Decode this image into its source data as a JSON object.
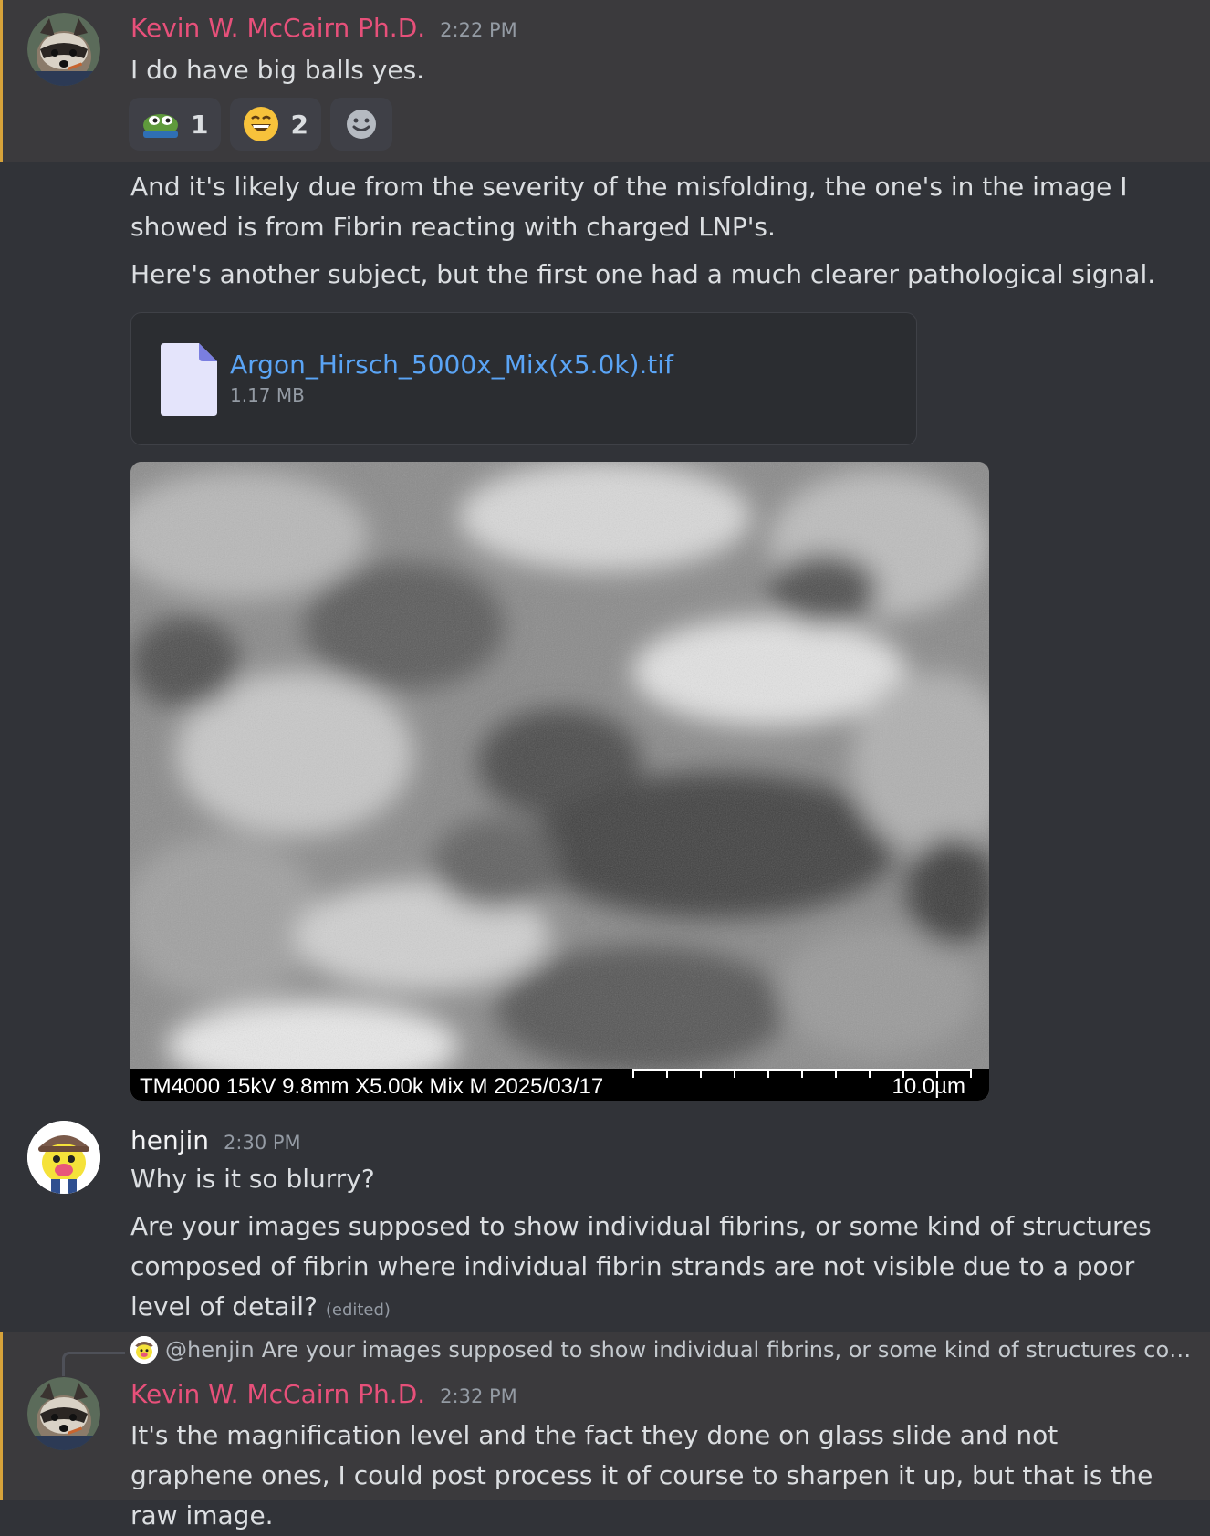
{
  "messages": {
    "kevin1": {
      "username": "Kevin W. McCairn Ph.D.",
      "timestamp": "2:22 PM",
      "text": "I do have big balls yes.",
      "reactions": [
        {
          "emoji": "pepe-frog-icon",
          "count": "1"
        },
        {
          "emoji": "grinning-face-icon",
          "count": "2"
        },
        {
          "emoji": "add-reaction-icon",
          "count": ""
        }
      ]
    },
    "kevin_cont": {
      "text1": "And it's likely due from the severity of the misfolding, the one's in the image I showed is from Fibrin reacting with charged LNP's.",
      "text2": "Here's another subject, but the first one had a much clearer pathological signal.",
      "file": {
        "name": "Argon_Hirsch_5000x_Mix(x5.0k).tif",
        "size": "1.17 MB"
      },
      "image": {
        "caption": "TM4000 15kV 9.8mm X5.00k Mix M 2025/03/17",
        "scale": "10.0µm"
      }
    },
    "henjin": {
      "username": "henjin",
      "timestamp": "2:30 PM",
      "text1": "Why is it so blurry?",
      "text2": "Are your images supposed to show individual fibrins, or some kind of structures composed of fibrin where individual fibrin strands are not visible due to a poor level of detail?",
      "edited": "(edited)"
    },
    "kevin2": {
      "reply": {
        "user": "@henjin",
        "text": "Are your images supposed to show individual fibrins, or some kind of structures com..."
      },
      "username": "Kevin W. McCairn Ph.D.",
      "timestamp": "2:32 PM",
      "text": "It's the magnification level and the fact they done on glass slide and not graphene ones, I could post process it of course to sharpen it up, but that is the raw image."
    }
  },
  "colors": {
    "background": "#313338",
    "highlight": "#3b3a3d",
    "highlight_bar": "#d6a23a",
    "kevin_name": "#e7507a",
    "link": "#5aa4f5"
  }
}
